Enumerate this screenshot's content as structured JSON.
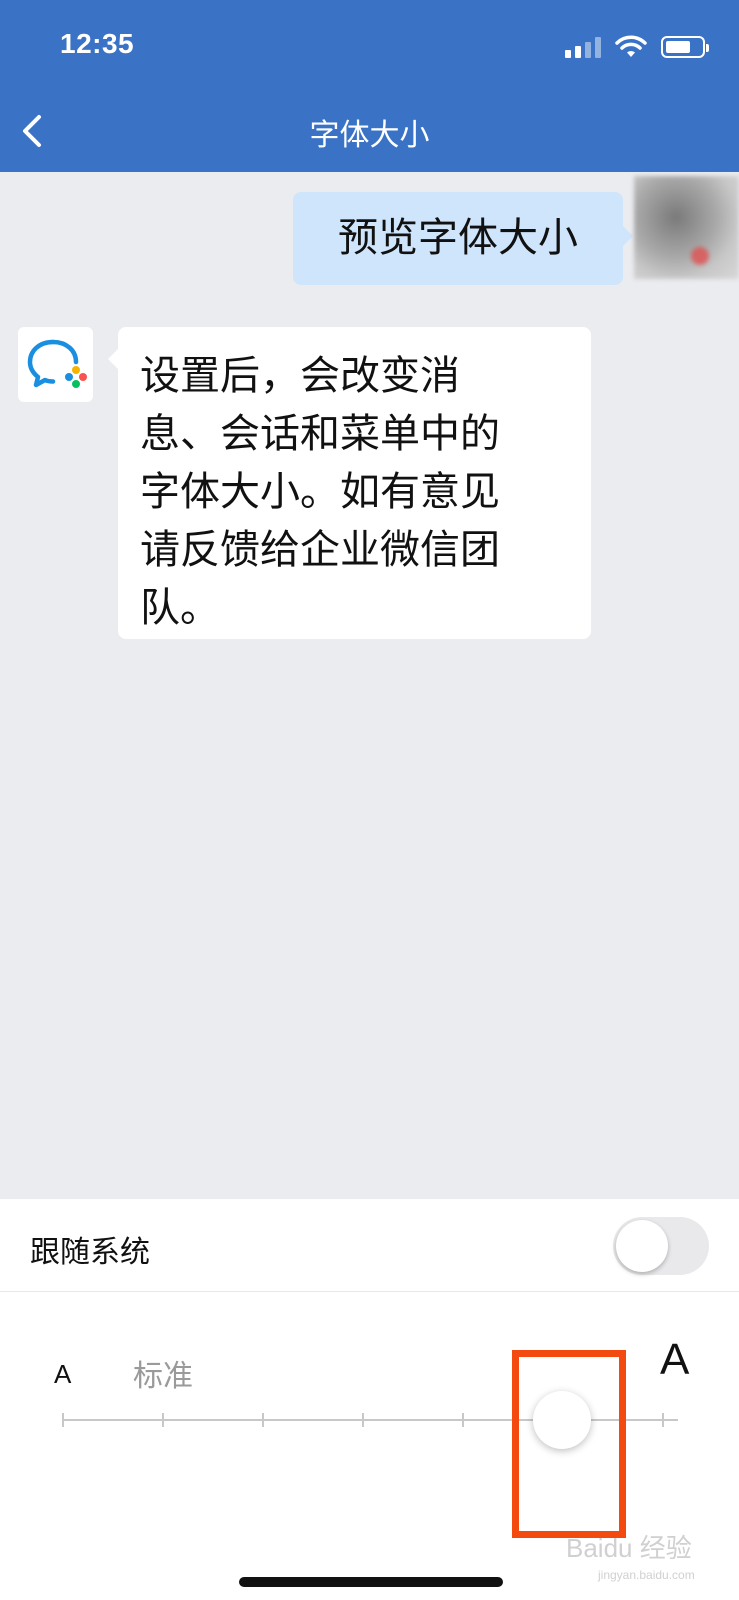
{
  "status_bar": {
    "time": "12:35",
    "icons": [
      "signal-icon",
      "wifi-icon",
      "battery-icon"
    ]
  },
  "header": {
    "title": "字体大小",
    "back_icon": "chevron-left-icon"
  },
  "chat": {
    "outgoing_message": "预览字体大小",
    "incoming_message_lines": [
      "设置后，会改变消",
      "息、会话和菜单中的",
      "字体大小。如有意见",
      "请反馈给企业微信团",
      "队。"
    ]
  },
  "settings": {
    "follow_system_label": "跟随系统",
    "follow_system_on": false,
    "small_a": "A",
    "standard_label": "标准",
    "large_a": "A",
    "font_size_steps": 7,
    "font_size_level": 5
  },
  "watermark": {
    "text": "Baidu 经验",
    "sub": "jingyan.baidu.com"
  },
  "colors": {
    "header_bg": "#3a73c6",
    "chat_bg": "#ebecf0",
    "outgoing_bubble": "#cfe5fb",
    "highlight": "#f24a0f"
  }
}
